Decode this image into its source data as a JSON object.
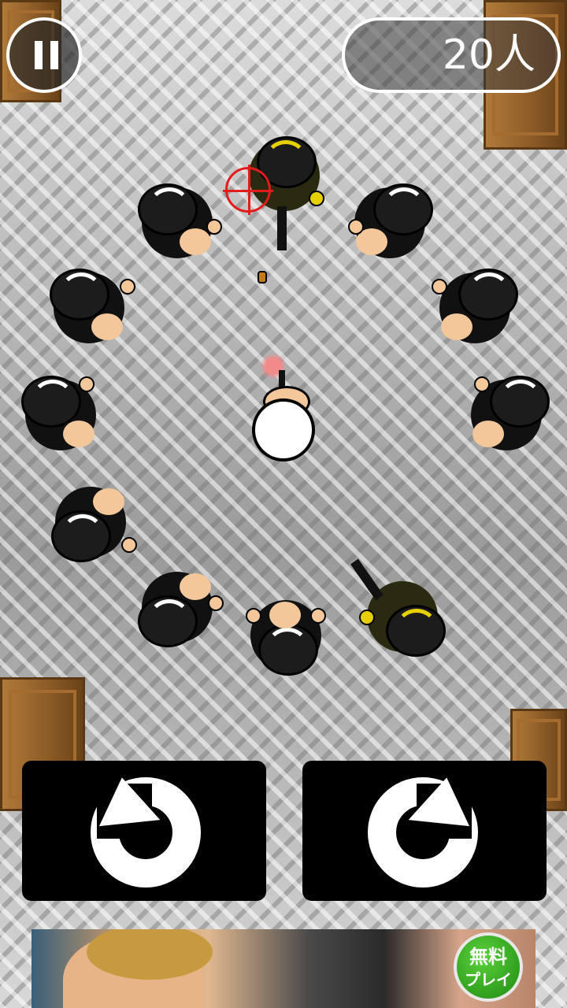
{
  "hud": {
    "counter_text": "20人",
    "pause_icon": "pause-icon"
  },
  "controls": {
    "rotate_left_icon": "rotate-counterclockwise-icon",
    "rotate_right_icon": "rotate-clockwise-icon"
  },
  "ad": {
    "badge_line1": "無料",
    "badge_line2": "プレイ"
  },
  "colors": {
    "crosshair": "#e21b1b",
    "boss_accent": "#e7d000",
    "button_bg": "#000000"
  }
}
